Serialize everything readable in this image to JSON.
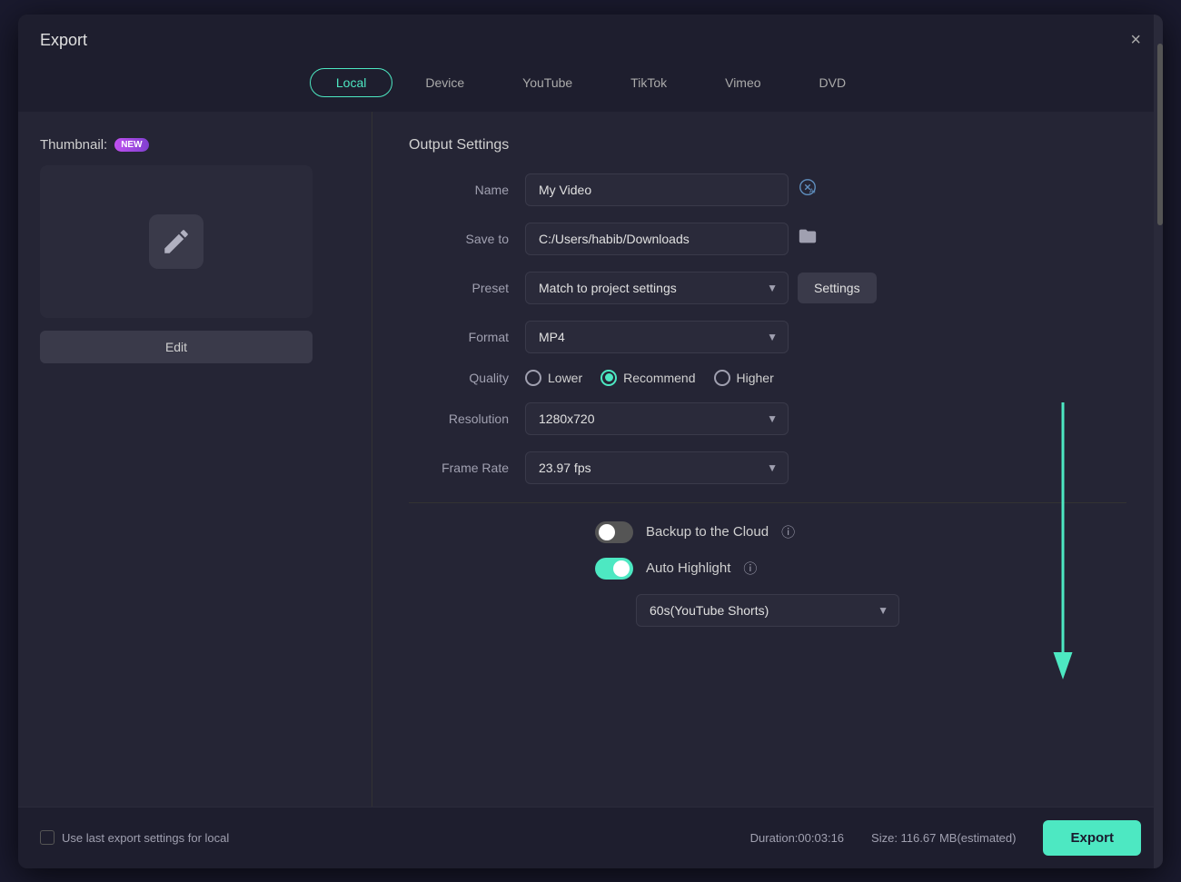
{
  "dialog": {
    "title": "Export",
    "close_label": "×"
  },
  "tabs": [
    {
      "label": "Local",
      "active": true
    },
    {
      "label": "Device",
      "active": false
    },
    {
      "label": "YouTube",
      "active": false
    },
    {
      "label": "TikTok",
      "active": false
    },
    {
      "label": "Vimeo",
      "active": false
    },
    {
      "label": "DVD",
      "active": false
    }
  ],
  "thumbnail": {
    "label": "Thumbnail:",
    "new_badge": "NEW",
    "edit_label": "Edit"
  },
  "output_settings": {
    "section_title": "Output Settings",
    "name_label": "Name",
    "name_value": "My Video",
    "save_to_label": "Save to",
    "save_to_value": "C:/Users/habib/Downloads",
    "preset_label": "Preset",
    "preset_value": "Match to project settings",
    "settings_btn": "Settings",
    "format_label": "Format",
    "format_value": "MP4",
    "quality_label": "Quality",
    "quality_lower": "Lower",
    "quality_recommend": "Recommend",
    "quality_higher": "Higher",
    "resolution_label": "Resolution",
    "resolution_value": "1280x720",
    "frame_rate_label": "Frame Rate",
    "frame_rate_value": "23.97 fps"
  },
  "toggles": {
    "backup_label": "Backup to the Cloud",
    "backup_on": false,
    "auto_highlight_label": "Auto Highlight",
    "auto_highlight_on": true
  },
  "highlight_dropdown": {
    "value": "60s(YouTube Shorts)"
  },
  "bottom": {
    "checkbox_label": "Use last export settings for local",
    "duration_label": "Duration:00:03:16",
    "size_label": "Size: 116.67 MB(estimated)",
    "export_btn": "Export"
  }
}
